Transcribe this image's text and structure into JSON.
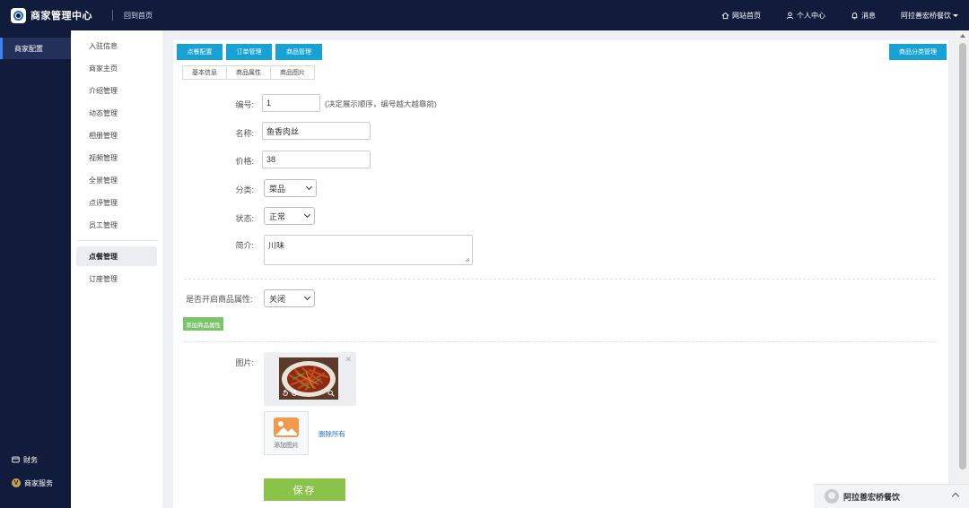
{
  "header": {
    "title": "商家管理中心",
    "back_home": "回到首页",
    "links": {
      "website_home": "网站首页",
      "personal_center": "个人中心",
      "messages": "消息",
      "shop_name": "阿拉善宏桥餐饮"
    }
  },
  "sidebar": {
    "active": "商家配置",
    "finance": "财务",
    "merchant_service": "商家服务",
    "v_badge": "V"
  },
  "submenu": {
    "items": [
      "入驻信息",
      "商家主页",
      "介绍管理",
      "动态管理",
      "相册管理",
      "视频管理",
      "全景管理",
      "点评管理",
      "员工管理"
    ],
    "items2": [
      "点餐管理",
      "订座管理"
    ],
    "active": "点餐管理"
  },
  "tabs": {
    "ordering_config": "点餐配置",
    "order_management": "订单管理",
    "product_management": "商品管理",
    "category_management": "商品分类管理"
  },
  "subtabs": [
    "基本信息",
    "商品属性",
    "商品图片"
  ],
  "form": {
    "number_label": "编号:",
    "number_value": "1",
    "number_hint": "(决定展示顺序，编号越大越靠前)",
    "name_label": "名称:",
    "name_value": "鱼香肉丝",
    "price_label": "价格:",
    "price_value": "38",
    "category_label": "分类:",
    "category_value": "菜品",
    "status_label": "状态:",
    "status_value": "正常",
    "intro_label": "简介:",
    "intro_value": "川味",
    "attr_toggle_label": "是否开启商品属性:",
    "attr_toggle_value": "关闭",
    "add_attr": "添加商品属性",
    "image_label": "图片:",
    "add_image": "添加图片",
    "delete_all": "删除所有",
    "save": "保存"
  },
  "chat": {
    "name": "阿拉善宏桥餐饮"
  },
  "colors": {
    "nav_bg": "#111c3d",
    "tab_blue": "#17a2d6",
    "save_green": "#8bc34a",
    "attr_green": "#7cc36e",
    "link_blue": "#1e73d6"
  }
}
